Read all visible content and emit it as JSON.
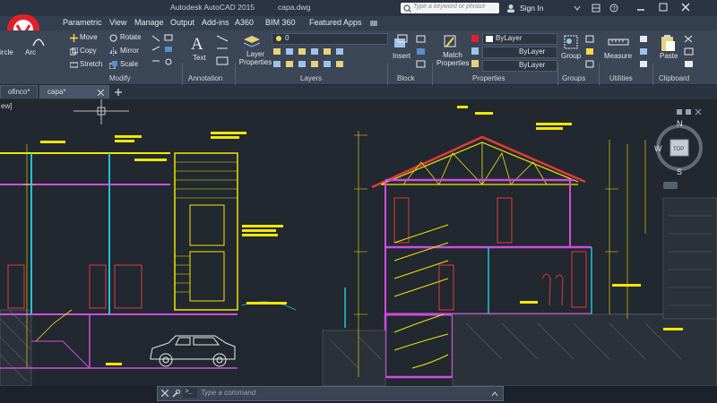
{
  "window": {
    "app_title": "Autodesk AutoCAD 2015",
    "file_name": "capa.dwg",
    "search_placeholder": "Type a keyword or phrase",
    "sign_in": "Sign In"
  },
  "menu": [
    "Parametric",
    "View",
    "Manage",
    "Output",
    "Add-ins",
    "A360",
    "BIM 360",
    "Featured Apps"
  ],
  "ribbon": {
    "draw": {
      "circle": "ircle",
      "arc": "Arc"
    },
    "modify": {
      "move": "Move",
      "rotate": "Rotate",
      "copy": "Copy",
      "mirror": "Mirror",
      "stretch": "Stretch",
      "scale": "Scale"
    },
    "annotation": {
      "text": "Text"
    },
    "layers": {
      "layer_properties": "Layer Properties",
      "layer_value": "0"
    },
    "block": {
      "insert": "Insert"
    },
    "properties": {
      "match_properties": "Match Properties",
      "color": "ByLayer",
      "linetype": "ByLayer",
      "lineweight": "ByLayer"
    },
    "groups": {
      "group": "Group"
    },
    "utilities": {
      "measure": "Measure"
    },
    "clipboard": {
      "paste": "Paste"
    },
    "panels": [
      "Modify",
      "Annotation",
      "Layers",
      "Block",
      "Properties",
      "Groups",
      "Utilities",
      "Clipboard"
    ]
  },
  "tabs": [
    "ofinco*",
    "capa*"
  ],
  "viewport": {
    "label": "ew]",
    "compass": {
      "n": "N",
      "s": "S",
      "w": "W",
      "top": "TOP"
    }
  },
  "command": {
    "placeholder": "Type a command"
  },
  "colors": {
    "background": "#212830",
    "yellow": "#f2e600",
    "cyan": "#22c3d8",
    "magenta": "#d24be0",
    "red": "#e23a3a",
    "accent": "#e3202a"
  }
}
